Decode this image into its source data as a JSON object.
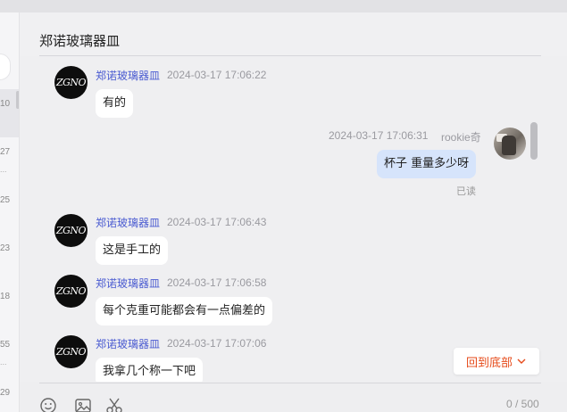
{
  "conversation": {
    "title": "郑诺玻璃器皿"
  },
  "contact_list_peek": {
    "numbers": [
      "10",
      "27",
      "25",
      "23",
      "18",
      "55",
      "29"
    ],
    "ellipsis": "..."
  },
  "messages": [
    {
      "sender": "郑诺玻璃器皿",
      "time": "2024-03-17 17:06:22",
      "text": "有的",
      "avatar_text": "ZGNO"
    },
    {
      "sender": "rookie奇",
      "time": "2024-03-17 17:06:31",
      "text": "杯子 重量多少呀",
      "status": "已读"
    },
    {
      "sender": "郑诺玻璃器皿",
      "time": "2024-03-17 17:06:43",
      "text": "这是手工的",
      "avatar_text": "ZGNO"
    },
    {
      "sender": "郑诺玻璃器皿",
      "time": "2024-03-17 17:06:58",
      "text": "每个克重可能都会有一点偏差的",
      "avatar_text": "ZGNO"
    },
    {
      "sender": "郑诺玻璃器皿",
      "time": "2024-03-17 17:07:06",
      "text": "我拿几个称一下吧",
      "avatar_text": "ZGNO"
    }
  ],
  "scroll_to_bottom": {
    "label": "回到底部"
  },
  "composer": {
    "char_count": "0 / 500"
  },
  "icons": [
    "emoji-icon",
    "image-icon",
    "scissors-icon",
    "chevron-down-icon"
  ],
  "colors": {
    "sender_name": "#4a5bd1",
    "my_bubble": "#d6e4fb",
    "accent": "#e64a19"
  }
}
